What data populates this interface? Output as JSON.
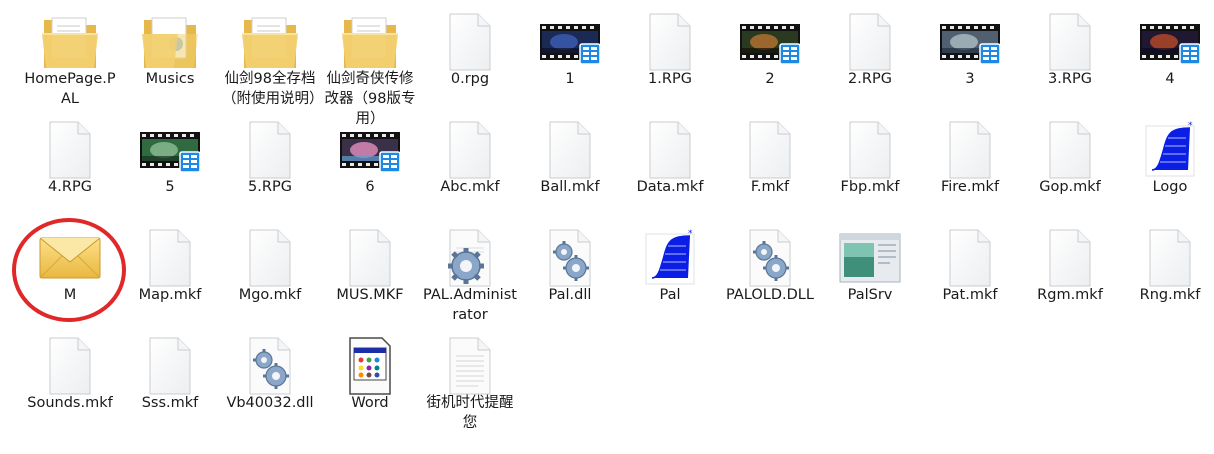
{
  "files": [
    {
      "name": "HomePage.PAL",
      "icon": "folder-doc-icon"
    },
    {
      "name": "Musics",
      "icon": "folder-music-icon"
    },
    {
      "name": "仙剑98全存档（附使用说明）",
      "icon": "folder-doc-icon"
    },
    {
      "name": "仙剑奇侠传修改器（98版专用）",
      "icon": "folder-doc-icon"
    },
    {
      "name": "0.rpg",
      "icon": "blank-file-icon"
    },
    {
      "name": "1",
      "icon": "video-file-icon"
    },
    {
      "name": "1.RPG",
      "icon": "blank-file-icon"
    },
    {
      "name": "2",
      "icon": "video-file-icon"
    },
    {
      "name": "2.RPG",
      "icon": "blank-file-icon"
    },
    {
      "name": "3",
      "icon": "video-file-icon"
    },
    {
      "name": "3.RPG",
      "icon": "blank-file-icon"
    },
    {
      "name": "4",
      "icon": "video-file-icon"
    },
    {
      "name": "4.RPG",
      "icon": "blank-file-icon"
    },
    {
      "name": "5",
      "icon": "video-file-icon"
    },
    {
      "name": "5.RPG",
      "icon": "blank-file-icon"
    },
    {
      "name": "6",
      "icon": "video-file-icon"
    },
    {
      "name": "Abc.mkf",
      "icon": "blank-file-icon"
    },
    {
      "name": "Ball.mkf",
      "icon": "blank-file-icon"
    },
    {
      "name": "Data.mkf",
      "icon": "blank-file-icon"
    },
    {
      "name": "F.mkf",
      "icon": "blank-file-icon"
    },
    {
      "name": "Fbp.mkf",
      "icon": "blank-file-icon"
    },
    {
      "name": "Fire.mkf",
      "icon": "blank-file-icon"
    },
    {
      "name": "Gop.mkf",
      "icon": "blank-file-icon"
    },
    {
      "name": "Logo",
      "icon": "pal-logo-icon"
    },
    {
      "name": "M",
      "icon": "envelope-icon"
    },
    {
      "name": "Map.mkf",
      "icon": "blank-file-icon"
    },
    {
      "name": "Mgo.mkf",
      "icon": "blank-file-icon"
    },
    {
      "name": "MUS.MKF",
      "icon": "blank-file-icon"
    },
    {
      "name": "PAL.Administrator",
      "icon": "gear-file-icon"
    },
    {
      "name": "Pal.dll",
      "icon": "dll-file-icon"
    },
    {
      "name": "Pal",
      "icon": "pal-logo-icon"
    },
    {
      "name": "PALOLD.DLL",
      "icon": "dll-file-icon"
    },
    {
      "name": "PalSrv",
      "icon": "app-window-icon"
    },
    {
      "name": "Pat.mkf",
      "icon": "blank-file-icon"
    },
    {
      "name": "Rgm.mkf",
      "icon": "blank-file-icon"
    },
    {
      "name": "Rng.mkf",
      "icon": "blank-file-icon"
    },
    {
      "name": "Sounds.mkf",
      "icon": "blank-file-icon"
    },
    {
      "name": "Sss.mkf",
      "icon": "blank-file-icon"
    },
    {
      "name": "Vb40032.dll",
      "icon": "dll-file-icon"
    },
    {
      "name": "Word",
      "icon": "word-exe-icon"
    },
    {
      "name": "街机时代提醒您",
      "icon": "text-file-icon"
    }
  ],
  "highlighted_file": "M",
  "colors": {
    "highlight": "#e02828",
    "folder": "#f2cf6e",
    "video_badge": "#1e88e5",
    "pal_logo": "#0a1ee6",
    "envelope": "#f4d36b"
  }
}
